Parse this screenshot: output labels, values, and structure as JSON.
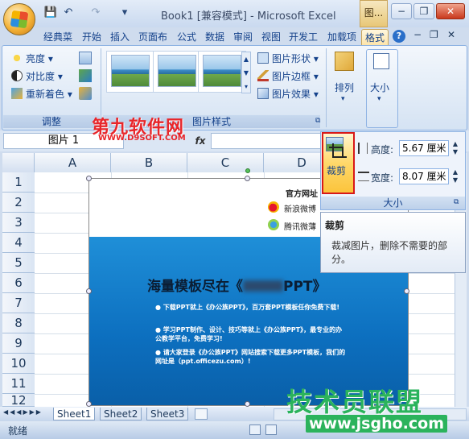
{
  "title": {
    "doc": "Book1  [兼容模式] - Microsoft Excel",
    "context_group": "图..."
  },
  "qat": {
    "save": "💾",
    "undo": "↶",
    "redo": "↷",
    "more": "▾"
  },
  "window": {
    "help": "?",
    "minimize": "−",
    "restore": "❐",
    "close": "✕"
  },
  "tabs": [
    "经典菜",
    "开始",
    "插入",
    "页面布",
    "公式",
    "数据",
    "审阅",
    "视图",
    "开发工",
    "加载项",
    "格式"
  ],
  "ribbon": {
    "adjust": {
      "brightness": "亮度",
      "contrast": "对比度",
      "recolor": "重新着色",
      "label": "调整"
    },
    "styles": {
      "shape": "图片形状",
      "border": "图片边框",
      "effects": "图片效果",
      "label": "图片样式"
    },
    "arrange": {
      "label": "排列"
    },
    "size": {
      "label": "大小"
    }
  },
  "formula_bar": {
    "name_box": "图片 1",
    "fx": "fx"
  },
  "columns": [
    "A",
    "B",
    "C",
    "D"
  ],
  "rows": [
    "1",
    "2",
    "3",
    "4",
    "5",
    "6",
    "7",
    "8",
    "9",
    "10",
    "11",
    "12"
  ],
  "picture": {
    "official_site": "官方网址",
    "weibo_sina": "新浪微博",
    "weibo_tencent": "腾讯微薄",
    "headline_a": "海量模板尽在《",
    "headline_b": "PPT》",
    "bullets": [
      "下载PPT就上《办公族PPT》，百万套PPT模板任你免费下载!",
      "学习PPT制作、设计、技巧等就上《办公族PPT》，最专业的办公教学平台，免费学习!",
      "请大家登录《办公族PPT》网站搜索下载更多PPT模板，我们的网址是（ppt.officezu.com）!"
    ]
  },
  "size_popup": {
    "crop_label": "裁剪",
    "height_label": "高度:",
    "height_value": "5.67 厘米",
    "width_label": "宽度:",
    "width_value": "8.07 厘米",
    "group_label": "大小"
  },
  "tooltip": {
    "title": "裁剪",
    "body": "裁减图片，删除不需要的部分。"
  },
  "sheets": [
    "Sheet1",
    "Sheet2",
    "Sheet3"
  ],
  "status": {
    "ready": "就绪"
  },
  "watermarks": {
    "top_cn": "第九软件网",
    "top_url": "WWW.D9SOFT.COM",
    "bottom_cn": "技术员联盟",
    "bottom_url": "www.jsgho.com"
  },
  "colors": {
    "accent": "#15428b",
    "crop_border": "#d81818",
    "picture_blue": "#0c6fbf"
  }
}
